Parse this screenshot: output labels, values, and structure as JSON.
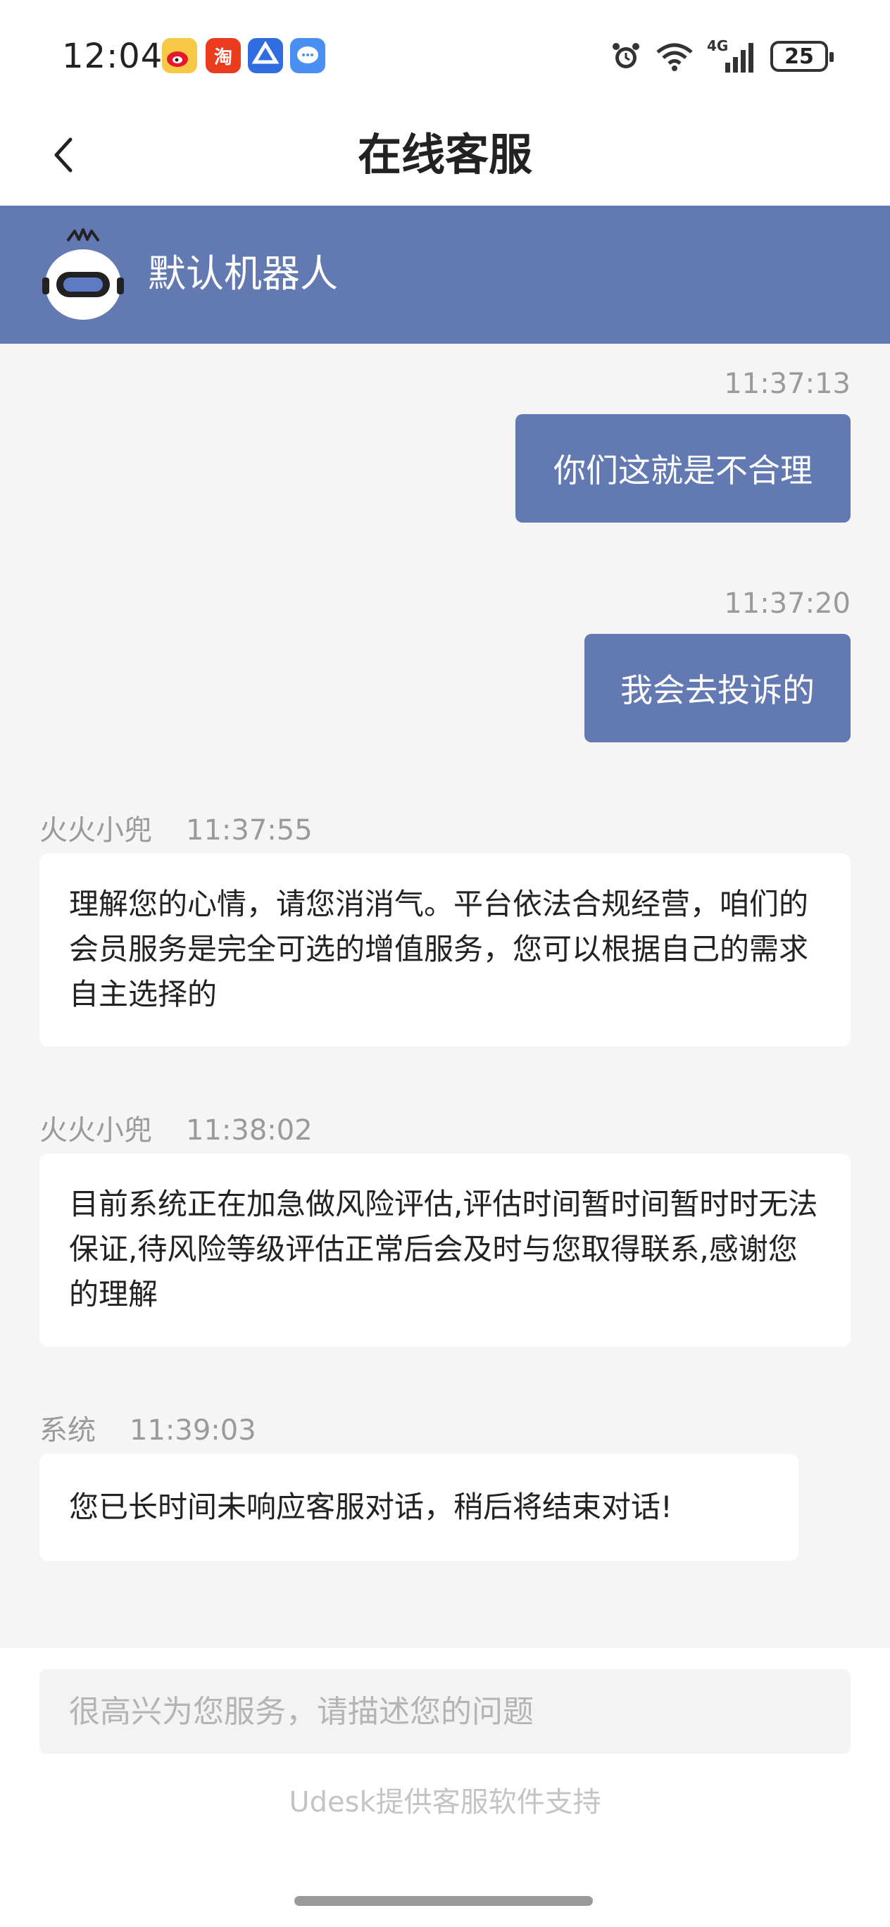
{
  "status_bar": {
    "time": "12:04",
    "network": "4G",
    "battery": "25",
    "notification_icons": [
      "weibo-icon",
      "taobao-icon",
      "baidu-icon",
      "message-icon"
    ]
  },
  "header": {
    "title": "在线客服"
  },
  "agent": {
    "name": "默认机器人"
  },
  "messages": [
    {
      "direction": "out",
      "time": "11:37:13",
      "text": "你们这就是不合理"
    },
    {
      "direction": "out",
      "time": "11:37:20",
      "text": "我会去投诉的"
    },
    {
      "direction": "in",
      "sender": "火火小兜",
      "time": "11:37:55",
      "text": "理解您的心情，请您消消气。平台依法合规经营，咱们的会员服务是完全可选的增值服务，您可以根据自己的需求自主选择的"
    },
    {
      "direction": "in",
      "sender": "火火小兜",
      "time": "11:38:02",
      "text": "目前系统正在加急做风险评估,评估时间暂时间暂时时无法保证,待风险等级评估正常后会及时与您取得联系,感谢您的理解"
    },
    {
      "direction": "in",
      "sender": "系统",
      "time": "11:39:03",
      "text": "您已长时间未响应客服对话，稍后将结束对话!"
    }
  ],
  "input": {
    "placeholder": "很高兴为您服务，请描述您的问题",
    "value": ""
  },
  "footer": {
    "powered_by": "Udesk提供客服软件支持"
  },
  "colors": {
    "accent": "#6279b2",
    "background": "#f5f5f5",
    "bubble_in": "#ffffff"
  }
}
